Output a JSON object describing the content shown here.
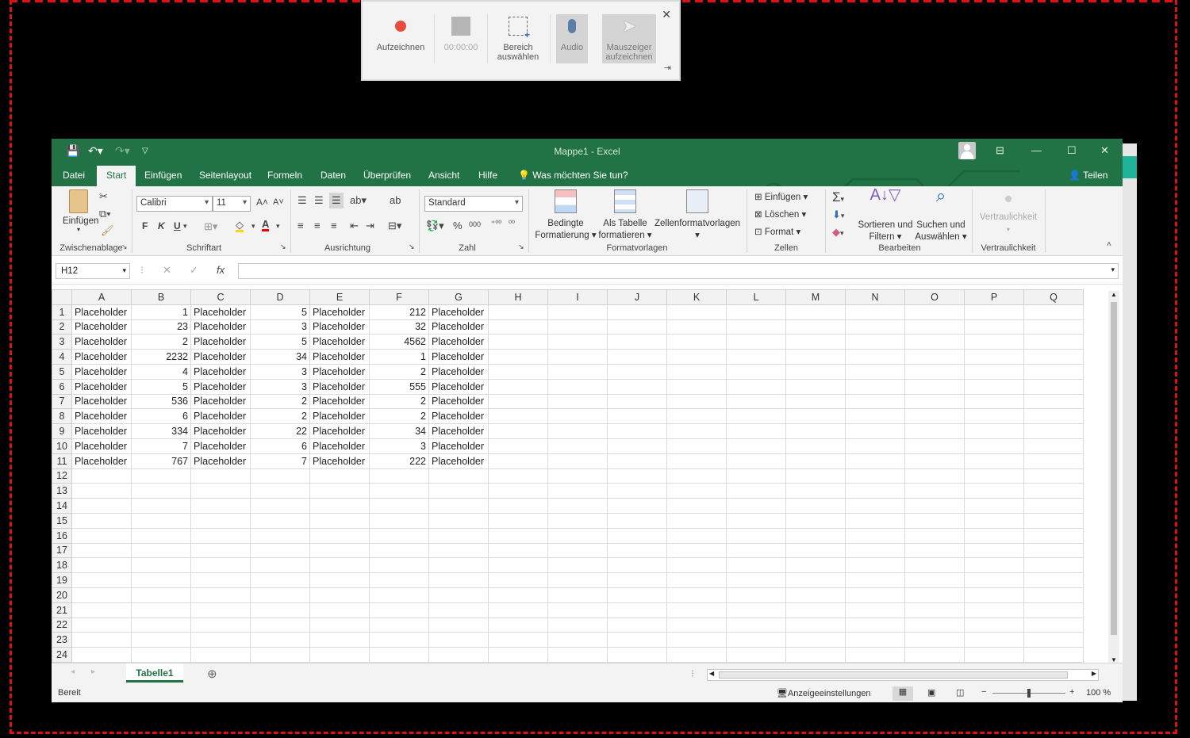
{
  "recorder": {
    "record": "Aufzeichnen",
    "timer": "00:00:00",
    "select_area": "Bereich auswählen",
    "audio": "Audio",
    "cursor": "Mauszeiger aufzeichnen",
    "close": "✕",
    "pin": "⇥"
  },
  "window": {
    "title": "Mappe1  -  Excel",
    "share": "Teilen"
  },
  "tabs": [
    "Datei",
    "Start",
    "Einfügen",
    "Seitenlayout",
    "Formeln",
    "Daten",
    "Überprüfen",
    "Ansicht",
    "Hilfe"
  ],
  "tell_me": "Was möchten Sie tun?",
  "ribbon": {
    "paste": "Einfügen",
    "clipboard_label": "Zwischenablage",
    "font_name": "Calibri",
    "font_size": "11",
    "bold": "F",
    "italic": "K",
    "underline": "U",
    "font_label": "Schriftart",
    "align_label": "Ausrichtung",
    "number_format": "Standard",
    "number_label": "Zahl",
    "cond_format_1": "Bedingte",
    "cond_format_2": "Formatierung",
    "as_table_1": "Als Tabelle",
    "as_table_2": "formatieren",
    "cell_styles": "Zellenformatvorlagen",
    "styles_label": "Formatvorlagen",
    "insert": "Einfügen",
    "delete": "Löschen",
    "format": "Format",
    "cells_label": "Zellen",
    "sort_1": "Sortieren und",
    "sort_2": "Filtern",
    "find_1": "Suchen und",
    "find_2": "Auswählen",
    "editing_label": "Bearbeiten",
    "sensitivity": "Vertraulichkeit",
    "sensitivity_label": "Vertraulichkeit"
  },
  "name_box": "H12",
  "columns": [
    "A",
    "B",
    "C",
    "D",
    "E",
    "F",
    "G",
    "H",
    "I",
    "J",
    "K",
    "L",
    "M",
    "N",
    "O",
    "P",
    "Q"
  ],
  "rows": [
    [
      "Placeholder",
      "1",
      "Placeholder",
      "5",
      "Placeholder",
      "212",
      "Placeholder"
    ],
    [
      "Placeholder",
      "23",
      "Placeholder",
      "3",
      "Placeholder",
      "32",
      "Placeholder"
    ],
    [
      "Placeholder",
      "2",
      "Placeholder",
      "5",
      "Placeholder",
      "4562",
      "Placeholder"
    ],
    [
      "Placeholder",
      "2232",
      "Placeholder",
      "34",
      "Placeholder",
      "1",
      "Placeholder"
    ],
    [
      "Placeholder",
      "4",
      "Placeholder",
      "3",
      "Placeholder",
      "2",
      "Placeholder"
    ],
    [
      "Placeholder",
      "5",
      "Placeholder",
      "3",
      "Placeholder",
      "555",
      "Placeholder"
    ],
    [
      "Placeholder",
      "536",
      "Placeholder",
      "2",
      "Placeholder",
      "2",
      "Placeholder"
    ],
    [
      "Placeholder",
      "6",
      "Placeholder",
      "2",
      "Placeholder",
      "2",
      "Placeholder"
    ],
    [
      "Placeholder",
      "334",
      "Placeholder",
      "22",
      "Placeholder",
      "34",
      "Placeholder"
    ],
    [
      "Placeholder",
      "7",
      "Placeholder",
      "6",
      "Placeholder",
      "3",
      "Placeholder"
    ],
    [
      "Placeholder",
      "767",
      "Placeholder",
      "7",
      "Placeholder",
      "222",
      "Placeholder"
    ]
  ],
  "row_count": 24,
  "sheet_tab": "Tabelle1",
  "status": {
    "ready": "Bereit",
    "display_settings": "Anzeigeeinstellungen",
    "zoom": "100 %"
  },
  "colors": {
    "excel_green": "#217346",
    "record_red": "#e74c3c",
    "frame_red": "#dd1111"
  }
}
